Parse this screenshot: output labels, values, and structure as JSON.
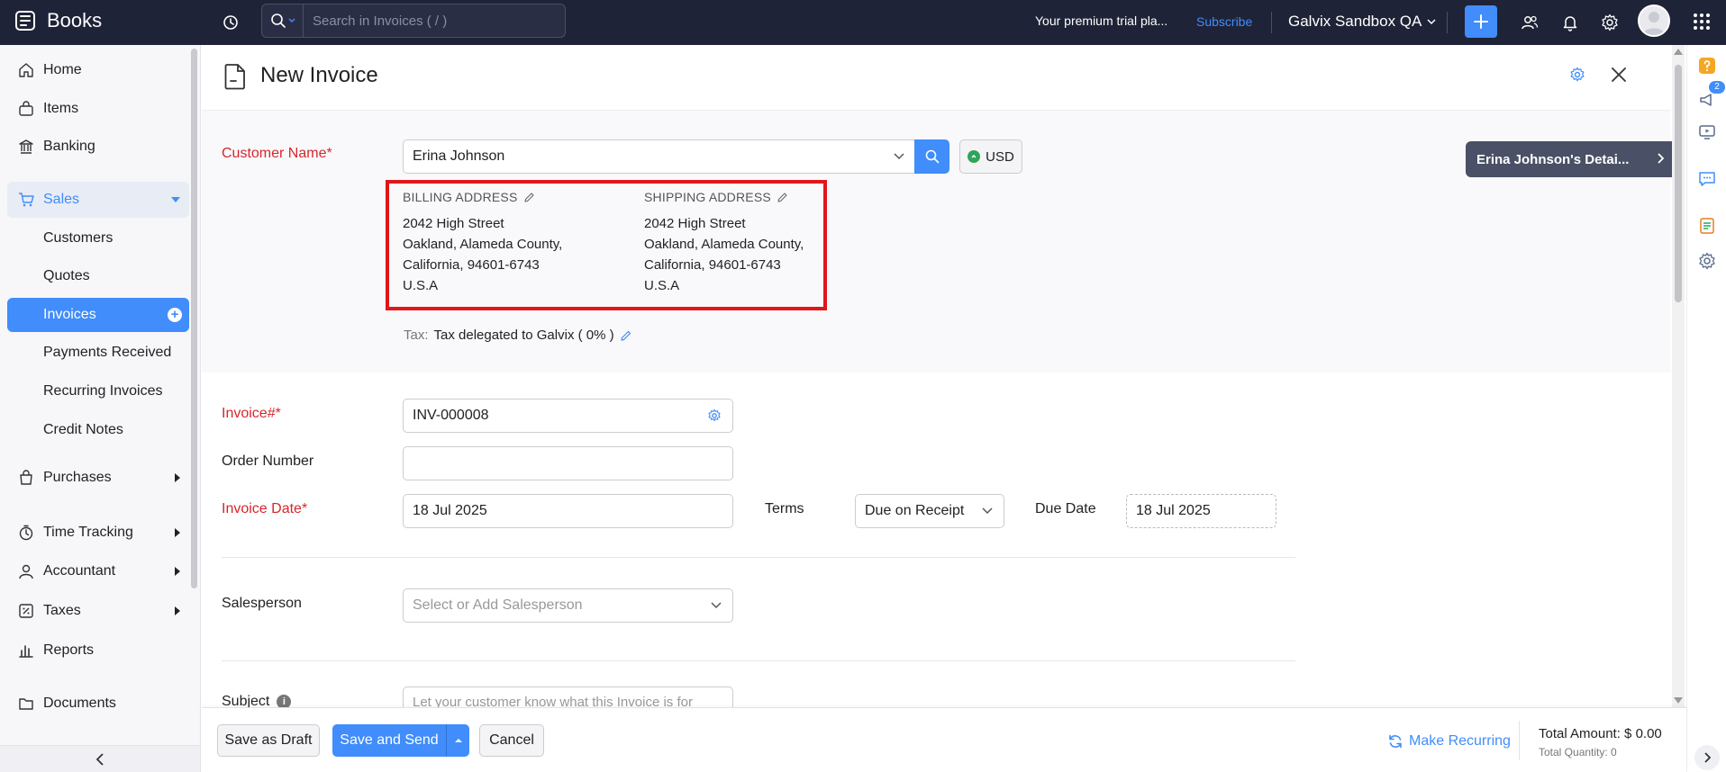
{
  "app": {
    "name": "Books"
  },
  "topbar": {
    "search_placeholder": "Search in Invoices ( / )",
    "trial_text": "Your premium trial pla...",
    "subscribe_label": "Subscribe",
    "org_name": "Galvix Sandbox QA"
  },
  "sidebar": {
    "home": "Home",
    "items": "Items",
    "banking": "Banking",
    "sales": "Sales",
    "customers": "Customers",
    "quotes": "Quotes",
    "invoices": "Invoices",
    "payments_received": "Payments Received",
    "recurring_invoices": "Recurring Invoices",
    "credit_notes": "Credit Notes",
    "purchases": "Purchases",
    "time_tracking": "Time Tracking",
    "accountant": "Accountant",
    "taxes": "Taxes",
    "reports": "Reports",
    "documents": "Documents"
  },
  "page": {
    "title": "New Invoice"
  },
  "customer": {
    "label": "Customer Name*",
    "value": "Erina Johnson",
    "currency": "USD",
    "details_button": "Erina Johnson's Detai...",
    "billing": {
      "heading": "BILLING ADDRESS",
      "lines": [
        "2042 High Street",
        "Oakland, Alameda County,",
        "California, 94601-6743",
        "U.S.A"
      ]
    },
    "shipping": {
      "heading": "SHIPPING ADDRESS",
      "lines": [
        "2042 High Street",
        "Oakland, Alameda County,",
        "California, 94601-6743",
        "U.S.A"
      ]
    },
    "tax_label": "Tax:",
    "tax_value": "Tax delegated to Galvix ( 0% )"
  },
  "form": {
    "invoice_number_label": "Invoice#*",
    "invoice_number": "INV-000008",
    "order_number_label": "Order Number",
    "order_number": "",
    "invoice_date_label": "Invoice Date*",
    "invoice_date": "18 Jul 2025",
    "terms_label": "Terms",
    "terms_value": "Due on Receipt",
    "due_date_label": "Due Date",
    "due_date": "18 Jul 2025",
    "salesperson_label": "Salesperson",
    "salesperson_placeholder": "Select or Add Salesperson",
    "subject_label": "Subject",
    "subject_placeholder": "Let your customer know what this Invoice is for"
  },
  "footer": {
    "save_draft": "Save as Draft",
    "save_send": "Save and Send",
    "cancel": "Cancel",
    "make_recurring": "Make Recurring",
    "total_amount": "Total Amount: $ 0.00",
    "total_quantity": "Total Quantity: 0"
  },
  "right_rail": {
    "notification_count": "2"
  },
  "colors": {
    "accent": "#408dfb",
    "topbar": "#1f2337",
    "required": "#d6262c",
    "highlight_box": "#e0161b"
  }
}
